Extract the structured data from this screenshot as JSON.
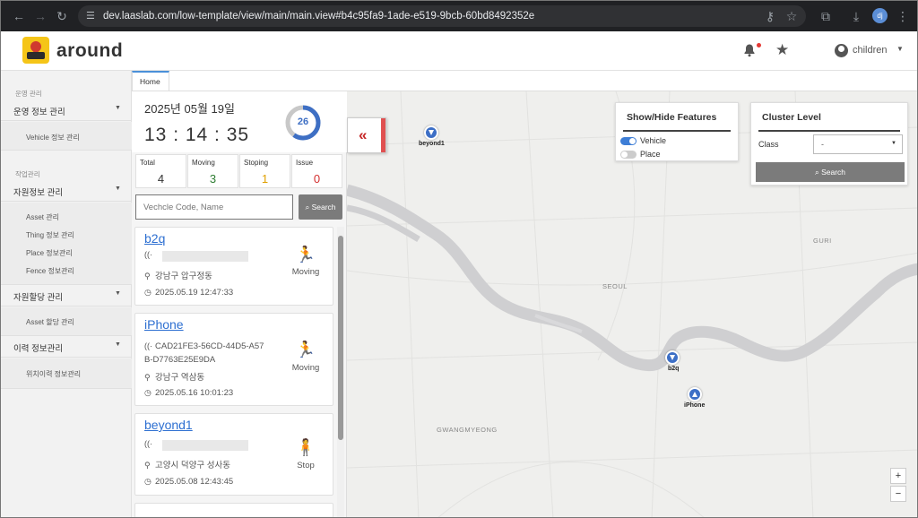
{
  "browser": {
    "url": "dev.laaslab.com/low-template/view/main/main.view#b4c95fa9-1ade-e519-9bcb-60bd8492352e",
    "profile_initials": "dj"
  },
  "app": {
    "logo_text": "around",
    "user_name": "children"
  },
  "sidebar": {
    "section1": "운영 관리",
    "group1": "운영 정보 관리",
    "group1_items": [
      "Vehicle 정보 관리"
    ],
    "section2": "작업관리",
    "group2": "자원정보 관리",
    "group2_items": [
      "Asset 관리",
      "Thing 정보 관리",
      "Place 정보관리",
      "Fence 정보관리"
    ],
    "group3": "자원할당 관리",
    "group3_items": [
      "Asset 할당 관리"
    ],
    "group4": "이력 정보관리",
    "group4_items": [
      "위치이력 정보관리"
    ]
  },
  "tabs": {
    "home": "Home"
  },
  "panel": {
    "date": "2025년 05월 19일",
    "time": "13 : 14 : 35",
    "ring_value": "26",
    "ring_fraction": 0.6,
    "stats": [
      {
        "label": "Total",
        "value": "4",
        "color": "#333333"
      },
      {
        "label": "Moving",
        "value": "3",
        "color": "#2e7d32"
      },
      {
        "label": "Stoping",
        "value": "1",
        "color": "#e0a000"
      },
      {
        "label": "Issue",
        "value": "0",
        "color": "#d32f2f"
      }
    ],
    "search_placeholder": "Vechcle Code, Name",
    "search_button": "Search"
  },
  "vehicles": [
    {
      "name": "b2q",
      "device": "",
      "address": "강남구 압구정동",
      "datetime": "2025.05.19 12:47:33",
      "status": "Moving"
    },
    {
      "name": "iPhone",
      "device": "CAD21FE3-56CD-44D5-A57B-D7763E25E9DA",
      "address": "강남구 역삼동",
      "datetime": "2025.05.16 10:01:23",
      "status": "Moving"
    },
    {
      "name": "beyond1",
      "device": "",
      "address": "고양시 덕양구 성사동",
      "datetime": "2025.05.08 12:43:45",
      "status": "Stop"
    }
  ],
  "map": {
    "show_hide_title": "Show/Hide Features",
    "toggle_vehicle": "Vehicle",
    "toggle_place": "Place",
    "cluster_title": "Cluster Level",
    "class_label": "Class",
    "class_value": "-",
    "cluster_search": "Search",
    "labels": [
      "SEOUL",
      "GURI",
      "GWANGMYEONG"
    ],
    "markers": [
      "beyond1",
      "b2q",
      "iPhone"
    ],
    "zoom_in": "+",
    "zoom_out": "−"
  }
}
